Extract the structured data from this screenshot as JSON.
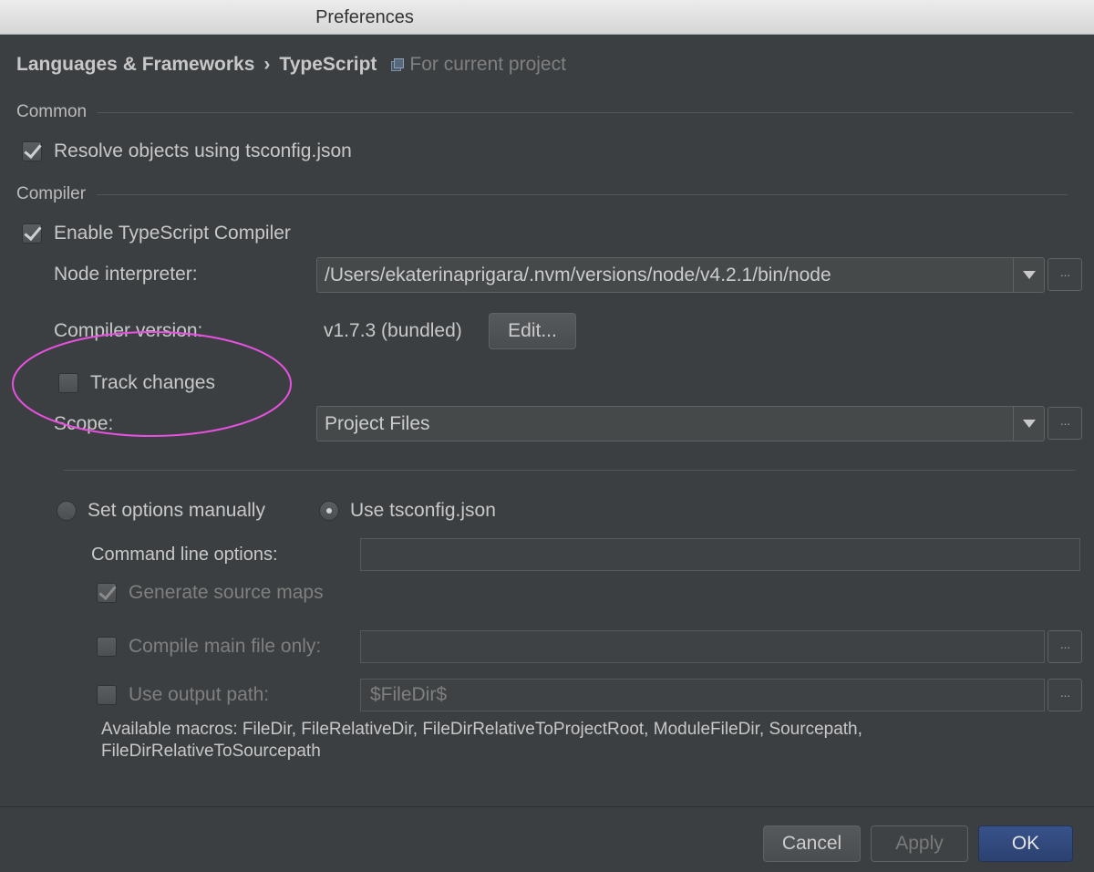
{
  "window": {
    "title": "Preferences"
  },
  "header": {
    "breadcrumb": [
      "Languages & Frameworks",
      "TypeScript"
    ],
    "separator": "›",
    "scope_note": "For current project"
  },
  "sections": {
    "common": "Common",
    "compiler": "Compiler"
  },
  "common": {
    "resolve_objects": {
      "label": "Resolve objects using tsconfig.json",
      "checked": true
    }
  },
  "compiler": {
    "enable": {
      "label": "Enable TypeScript Compiler",
      "checked": true
    },
    "node_interpreter": {
      "label": "Node interpreter:",
      "value": "/Users/ekaterinaprigara/.nvm/versions/node/v4.2.1/bin/node"
    },
    "compiler_version": {
      "label": "Compiler version:",
      "value": "v1.7.3 (bundled)",
      "edit_label": "Edit..."
    },
    "track_changes": {
      "label": "Track changes",
      "checked": false
    },
    "scope": {
      "label": "Scope:",
      "value": "Project Files"
    },
    "options_mode": {
      "manual_label": "Set options manually",
      "tsconfig_label": "Use tsconfig.json",
      "selected": "tsconfig"
    },
    "command_line": {
      "label": "Command line options:",
      "value": ""
    },
    "source_maps": {
      "label": "Generate source maps",
      "checked": true
    },
    "main_file_only": {
      "label": "Compile main file only:",
      "checked": false,
      "value": ""
    },
    "output_path": {
      "label": "Use output path:",
      "checked": false,
      "value": "$FileDir$"
    },
    "macros": "Available macros: FileDir, FileRelativeDir, FileDirRelativeToProjectRoot, ModuleFileDir, Sourcepath, FileDirRelativeToSourcepath"
  },
  "browse_label": "···",
  "buttons": {
    "cancel": "Cancel",
    "apply": "Apply",
    "ok": "OK"
  },
  "colors": {
    "background": "#3c3f41",
    "highlight_ring": "#e651e0",
    "primary_button": "#2f4678"
  }
}
